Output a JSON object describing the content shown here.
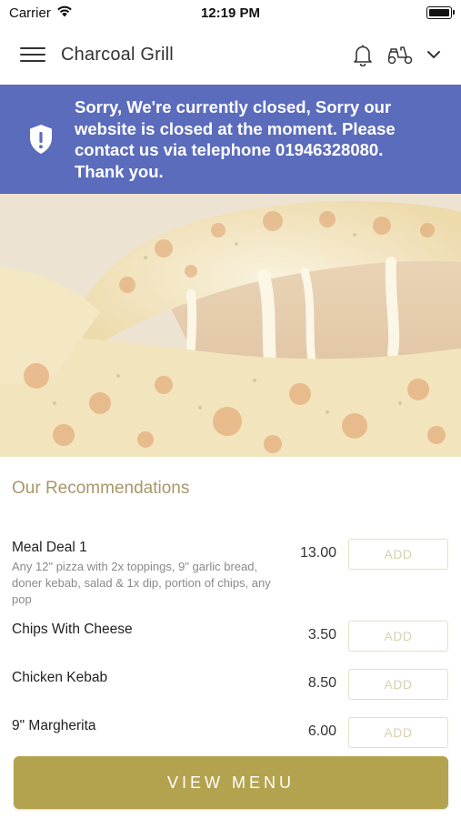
{
  "status_bar": {
    "carrier": "Carrier",
    "time": "12:19 PM"
  },
  "header": {
    "title": "Charcoal Grill",
    "icons": [
      "menu-icon",
      "bell-icon",
      "scooter-icon",
      "chevron-down-icon"
    ]
  },
  "banner": {
    "message": "Sorry, We're currently closed, Sorry our website is closed at the moment. Please contact us via telephone 01946328080. Thank you.",
    "icon": "shield-icon",
    "color": "#5b6cbd"
  },
  "hero": {
    "image": "cheese pizza slice"
  },
  "recommendations": {
    "title": "Our Recommendations",
    "items": [
      {
        "name": "Meal Deal 1",
        "description": "Any 12\" pizza with 2x toppings, 9\" garlic bread, doner kebab, salad & 1x dip, portion of chips, any pop",
        "price": "13.00",
        "add_label": "ADD"
      },
      {
        "name": "Chips With Cheese",
        "description": "",
        "price": "3.50",
        "add_label": "ADD"
      },
      {
        "name": "Chicken Kebab",
        "description": "",
        "price": "8.50",
        "add_label": "ADD"
      },
      {
        "name": "9\" Margherita",
        "description": "",
        "price": "6.00",
        "add_label": "ADD"
      }
    ]
  },
  "footer": {
    "view_menu_label": "VIEW MENU",
    "accent_color": "#b4a34e"
  }
}
